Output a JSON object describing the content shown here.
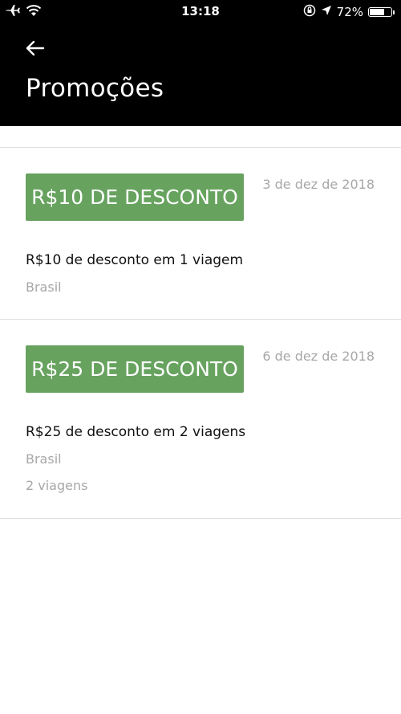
{
  "status_bar": {
    "time": "13:18",
    "battery": "72%",
    "battery_level": 0.72,
    "icons": [
      "airplane-icon",
      "wifi-icon",
      "orientation-lock-icon",
      "location-arrow-icon",
      "battery-icon"
    ]
  },
  "header": {
    "title": "Promoções",
    "back_icon": "arrow-left-icon"
  },
  "colors": {
    "header_bg": "#000000",
    "badge_green": "#67a35f",
    "muted_text": "#a7a7a7"
  },
  "promotions": [
    {
      "badge": "R$10 DE DESCONTO",
      "date": "3 de dez de 2018",
      "description": "R$10 de desconto em 1 viagem",
      "location": "Brasil"
    },
    {
      "badge": "R$25 DE DESCONTO",
      "date": "6 de dez de 2018",
      "description": "R$25 de desconto em 2 viagens",
      "location": "Brasil",
      "trips": "2 viagens"
    }
  ]
}
